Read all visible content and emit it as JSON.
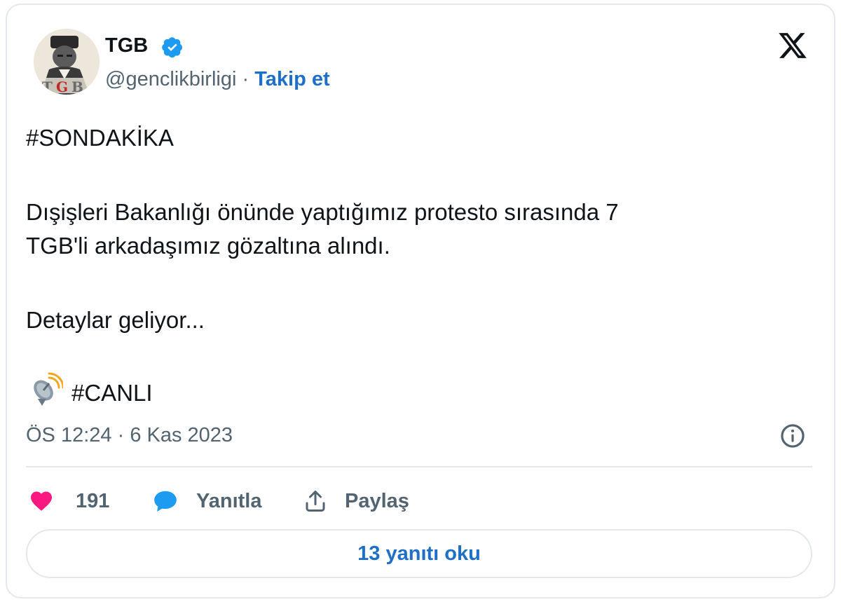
{
  "author": {
    "name": "TGB",
    "handle": "@genclikbirligi",
    "separator": "·",
    "follow_label": "Takip et",
    "avatar_text": "TGB"
  },
  "tweet": {
    "hashtag_top": "#SONDAKİKA",
    "line1": "Dışişleri Bakanlığı önünde yaptığımız protesto sırasında 7",
    "line2": "TGB'li arkadaşımız gözaltına alındı.",
    "line3": "Detaylar geliyor...",
    "hashtag_bottom": "#CANLI",
    "emoji_icon": "satellite-antenna-icon"
  },
  "meta": {
    "time": "ÖS 12:24",
    "separator": "·",
    "date": "6 Kas 2023"
  },
  "actions": {
    "like_count": "191",
    "reply_label": "Yanıtla",
    "share_label": "Paylaş"
  },
  "read_replies_label": "13 yanıtı oku",
  "colors": {
    "link": "#1d6fc8",
    "text": "#0f1419",
    "muted": "#536471",
    "like": "#f91880",
    "reply": "#1d9bf0",
    "verified": "#1d9bf0",
    "border": "#e3e8ec"
  }
}
